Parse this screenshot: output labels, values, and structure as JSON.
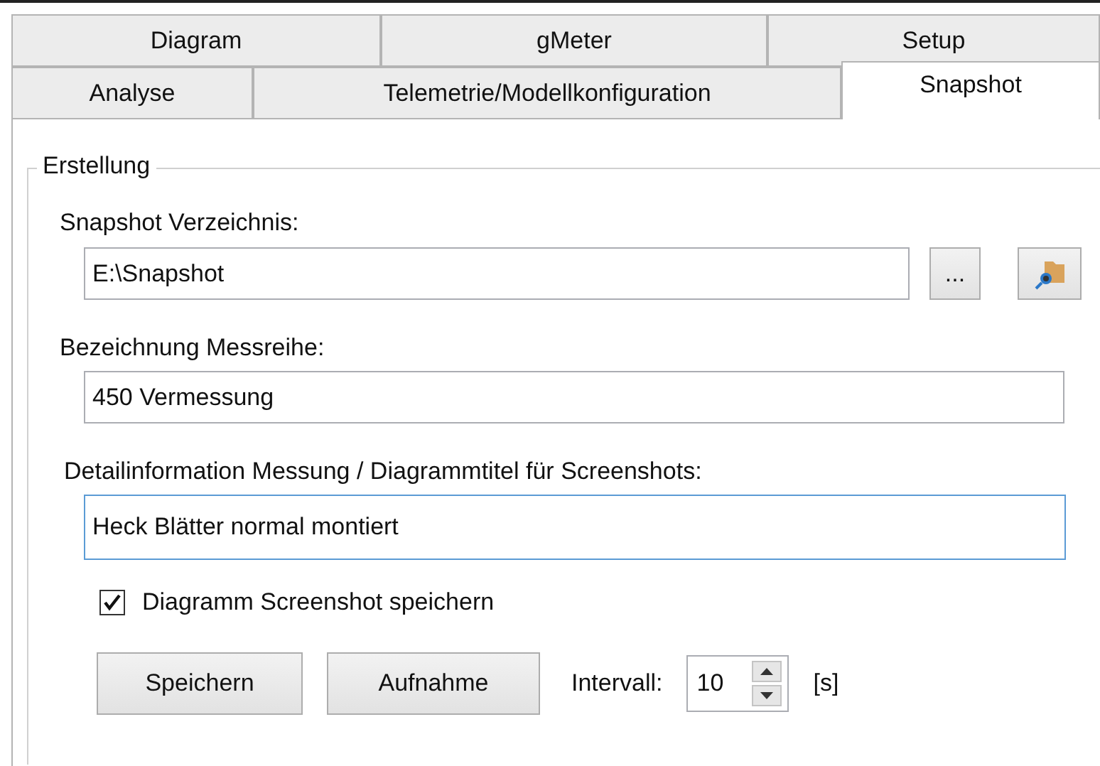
{
  "tab_rows": [
    [
      {
        "label": "Diagram",
        "selected": false
      },
      {
        "label": "gMeter",
        "selected": false
      },
      {
        "label": "Setup",
        "selected": false
      }
    ],
    [
      {
        "label": "Analyse",
        "selected": false
      },
      {
        "label": "Telemetrie/Modellkonfiguration",
        "selected": false
      },
      {
        "label": "Snapshot",
        "selected": true
      }
    ]
  ],
  "group": {
    "title": "Erstellung",
    "directory": {
      "label": "Snapshot Verzeichnis:",
      "value": "E:\\Snapshot",
      "browse": "..."
    },
    "series": {
      "label": "Bezeichnung Messreihe:",
      "value": "450 Vermessung"
    },
    "detail": {
      "label": "Detailinformation Messung / Diagrammtitel für Screenshots:",
      "value": "Heck Blätter normal montiert",
      "focused": true
    },
    "save_screenshot": {
      "label": "Diagramm Screenshot speichern",
      "checked": true
    },
    "buttons": [
      "Speichern",
      "Aufnahme"
    ],
    "interval": {
      "label": "Intervall:",
      "value": "10",
      "unit": "[s]"
    }
  }
}
